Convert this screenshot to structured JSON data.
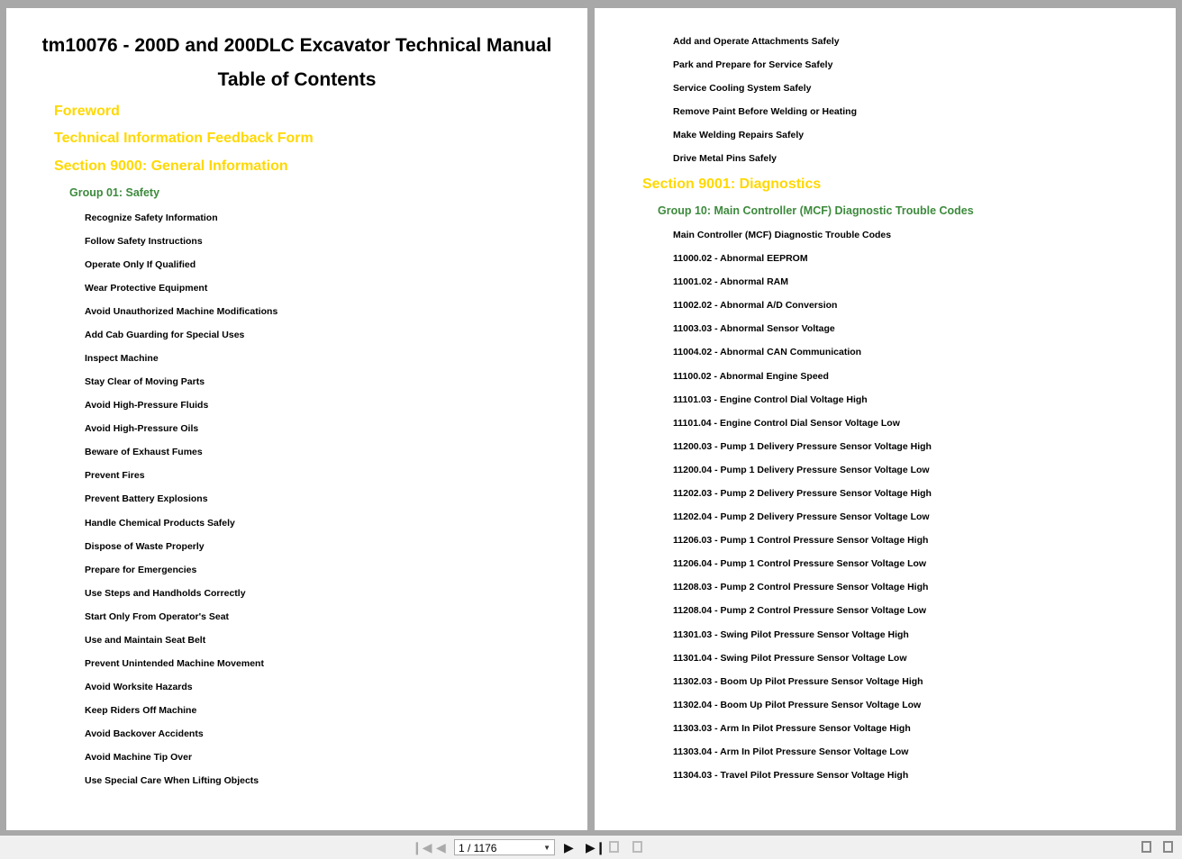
{
  "left_page": {
    "title": "tm10076 - 200D and 200DLC Excavator Technical Manual",
    "subtitle": "Table of Contents",
    "sections": [
      "Foreword",
      "Technical Information Feedback Form",
      "Section 9000: General Information"
    ],
    "group": "Group 01: Safety",
    "items": [
      "Recognize Safety Information",
      "Follow Safety Instructions",
      "Operate Only If Qualified",
      "Wear Protective Equipment",
      "Avoid Unauthorized Machine Modifications",
      "Add Cab Guarding for Special Uses",
      "Inspect Machine",
      "Stay Clear of Moving Parts",
      "Avoid High-Pressure Fluids",
      "Avoid High-Pressure Oils",
      "Beware of Exhaust Fumes",
      "Prevent Fires",
      "Prevent Battery Explosions",
      "Handle Chemical Products Safely",
      "Dispose of Waste Properly",
      "Prepare for Emergencies",
      "Use Steps and Handholds Correctly",
      "Start Only From Operator's Seat",
      "Use and Maintain Seat Belt",
      "Prevent Unintended Machine Movement",
      "Avoid Worksite Hazards",
      "Keep Riders Off Machine",
      "Avoid Backover Accidents",
      "Avoid Machine Tip Over",
      "Use Special Care When Lifting Objects"
    ]
  },
  "right_page": {
    "items_top": [
      "Add and Operate Attachments Safely",
      "Park and Prepare for Service Safely",
      "Service Cooling System Safely",
      "Remove Paint Before Welding or Heating",
      "Make Welding Repairs Safely",
      "Drive Metal Pins Safely"
    ],
    "section": "Section 9001: Diagnostics",
    "group": "Group 10: Main Controller (MCF) Diagnostic Trouble Codes",
    "items": [
      "Main Controller (MCF) Diagnostic Trouble Codes",
      "11000.02 - Abnormal EEPROM",
      "11001.02 - Abnormal RAM",
      "11002.02 - Abnormal A/D Conversion",
      "11003.03 - Abnormal Sensor Voltage",
      "11004.02 - Abnormal CAN Communication",
      "11100.02 - Abnormal Engine Speed",
      "11101.03 - Engine Control Dial Voltage High",
      "11101.04 - Engine Control Dial Sensor Voltage Low",
      "11200.03 - Pump 1 Delivery Pressure Sensor Voltage High",
      "11200.04 - Pump 1 Delivery Pressure Sensor Voltage Low",
      "11202.03 - Pump 2 Delivery Pressure Sensor Voltage High",
      "11202.04 - Pump 2 Delivery Pressure Sensor Voltage Low",
      "11206.03 - Pump 1 Control Pressure Sensor Voltage High",
      "11206.04 - Pump 1 Control Pressure Sensor Voltage Low",
      "11208.03 - Pump 2 Control Pressure Sensor Voltage High",
      "11208.04 - Pump 2 Control Pressure Sensor Voltage Low",
      "11301.03 - Swing Pilot Pressure Sensor Voltage High",
      "11301.04 - Swing Pilot Pressure Sensor Voltage Low",
      "11302.03 - Boom Up Pilot Pressure Sensor Voltage High",
      "11302.04 - Boom Up Pilot Pressure Sensor Voltage Low",
      "11303.03 - Arm In Pilot Pressure Sensor Voltage High",
      "11303.04 - Arm In Pilot Pressure Sensor Voltage Low",
      "11304.03 - Travel Pilot Pressure Sensor Voltage High"
    ]
  },
  "toolbar": {
    "page_indicator": "1 / 1176"
  }
}
